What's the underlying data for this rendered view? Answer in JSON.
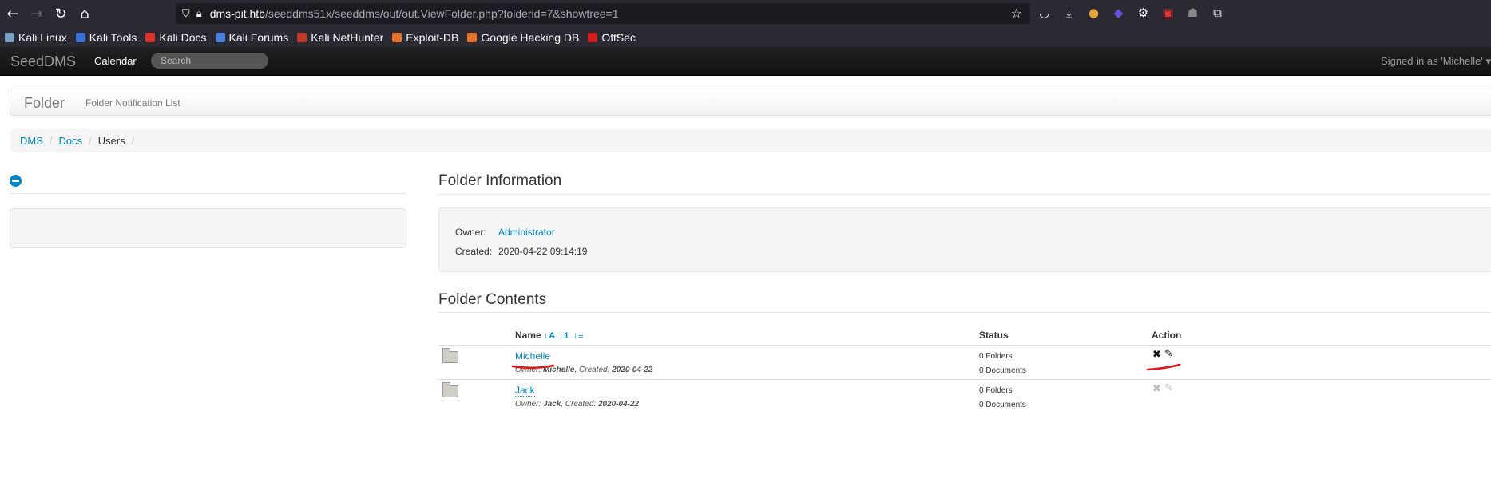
{
  "browser": {
    "url_host": "dms-pit.htb",
    "url_rest": "/seeddms51x/seeddms/out/out.ViewFolder.php?folderid=7&showtree=1"
  },
  "bookmarks": [
    {
      "label": "Kali Linux",
      "color": "#7aa0c4"
    },
    {
      "label": "Kali Tools",
      "color": "#3b6fd6"
    },
    {
      "label": "Kali Docs",
      "color": "#d9342b"
    },
    {
      "label": "Kali Forums",
      "color": "#4a7fd9"
    },
    {
      "label": "Kali NetHunter",
      "color": "#c0392b"
    },
    {
      "label": "Exploit-DB",
      "color": "#e8732a"
    },
    {
      "label": "Google Hacking DB",
      "color": "#e8732a"
    },
    {
      "label": "OffSec",
      "color": "#d21e1e"
    }
  ],
  "app": {
    "brand": "SeedDMS",
    "nav_calendar": "Calendar",
    "search_placeholder": "Search",
    "signed_in": "Signed in as 'Michelle' ▾"
  },
  "subnav": {
    "title": "Folder",
    "link": "Folder Notification List"
  },
  "breadcrumb": [
    "DMS",
    "Docs",
    "Users"
  ],
  "folder_info": {
    "heading": "Folder Information",
    "owner_label": "Owner:",
    "owner_value": "Administrator",
    "created_label": "Created:",
    "created_value": "2020-04-22 09:14:19"
  },
  "folder_contents": {
    "heading": "Folder Contents",
    "col_name": "Name",
    "col_status": "Status",
    "col_action": "Action",
    "rows": [
      {
        "name": "Michelle",
        "owner_label": "Owner:",
        "owner": "Michelle",
        "created_label": ", Created:",
        "created": "2020-04-22",
        "folders": "0 Folders",
        "documents": "0 Documents"
      },
      {
        "name": "Jack",
        "owner_label": "Owner:",
        "owner": "Jack",
        "created_label": ", Created:",
        "created": "2020-04-22",
        "folders": "0 Folders",
        "documents": "0 Documents"
      }
    ]
  }
}
